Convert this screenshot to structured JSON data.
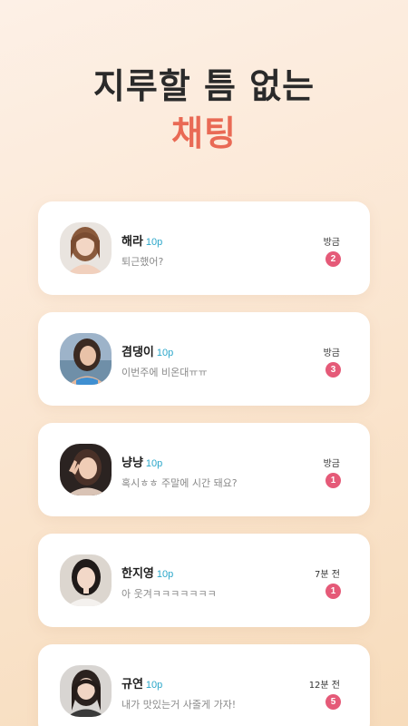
{
  "headline": {
    "line1": "지루할 틈 없는",
    "line2": "채팅"
  },
  "chats": [
    {
      "name": "해라",
      "points": "10p",
      "message": "퇴근했어?",
      "time": "방금",
      "unread": "2"
    },
    {
      "name": "겸댕이",
      "points": "10p",
      "message": "이번주에 비온대ㅠㅠ",
      "time": "방금",
      "unread": "3"
    },
    {
      "name": "냥냥",
      "points": "10p",
      "message": "혹시ㅎㅎ 주말에 시간 돼요?",
      "time": "방금",
      "unread": "1"
    },
    {
      "name": "한지영",
      "points": "10p",
      "message": "아 웃겨ㅋㅋㅋㅋㅋㅋㅋ",
      "time": "7분 전",
      "unread": "1"
    },
    {
      "name": "규연",
      "points": "10p",
      "message": "내가 맛있는거 사줄게 가자!",
      "time": "12분 전",
      "unread": "5"
    }
  ],
  "colors": {
    "accent": "#e96a55",
    "points": "#2aa6c9",
    "badge": "#e55a78"
  }
}
